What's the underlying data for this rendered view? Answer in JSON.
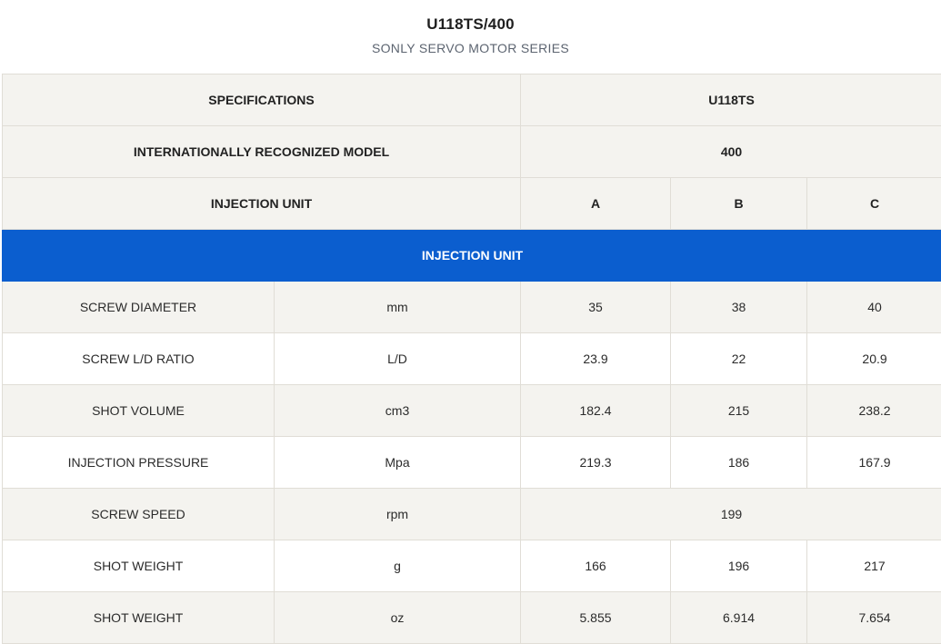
{
  "header": {
    "title": "U118TS/400",
    "subtitle": "SONLY SERVO MOTOR SERIES"
  },
  "table": {
    "spec_label": "SPECIFICATIONS",
    "spec_value": "U118TS",
    "model_label": "INTERNATIONALLY RECOGNIZED MODEL",
    "model_value": "400",
    "unit_label": "INJECTION UNIT",
    "unit_a": "A",
    "unit_b": "B",
    "unit_c": "C",
    "section_title": "INJECTION UNIT",
    "rows": [
      {
        "name": "SCREW DIAMETER",
        "unit": "mm",
        "a": "35",
        "b": "38",
        "c": "40"
      },
      {
        "name": "SCREW L/D RATIO",
        "unit": "L/D",
        "a": "23.9",
        "b": "22",
        "c": "20.9"
      },
      {
        "name": "SHOT VOLUME",
        "unit": "cm3",
        "a": "182.4",
        "b": "215",
        "c": "238.2"
      },
      {
        "name": "INJECTION PRESSURE",
        "unit": "Mpa",
        "a": "219.3",
        "b": "186",
        "c": "167.9"
      },
      {
        "name": "SCREW SPEED",
        "unit": "rpm",
        "merged": "199"
      },
      {
        "name": "SHOT WEIGHT",
        "unit": "g",
        "a": "166",
        "b": "196",
        "c": "217"
      },
      {
        "name": "SHOT WEIGHT",
        "unit": "oz",
        "a": "5.855",
        "b": "6.914",
        "c": "7.654"
      }
    ]
  }
}
